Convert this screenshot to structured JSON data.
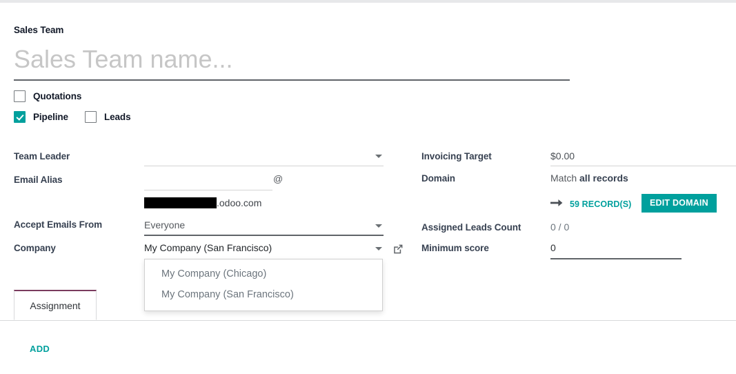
{
  "form": {
    "title_label": "Sales Team",
    "name_placeholder": "Sales Team name...",
    "name_value": ""
  },
  "options": [
    {
      "label": "Quotations",
      "checked": false
    },
    {
      "label": "Pipeline",
      "checked": true
    },
    {
      "label": "Leads",
      "checked": false
    }
  ],
  "left_fields": {
    "team_leader": {
      "label": "Team Leader",
      "value": ""
    },
    "email_alias": {
      "label": "Email Alias",
      "value": "",
      "at_symbol": "@",
      "domain_suffix": ".odoo.com",
      "domain_redacted": true
    },
    "accept_emails_from": {
      "label": "Accept Emails From",
      "value": "Everyone"
    },
    "company": {
      "label": "Company",
      "value": "My Company (San Francisco)"
    }
  },
  "right_fields": {
    "invoicing_target": {
      "label": "Invoicing Target",
      "value": "$0.00"
    },
    "domain": {
      "label": "Domain",
      "match_prefix": "Match ",
      "match_strong": "all records",
      "arrow_icon": "arrow-right-icon",
      "records_link": "59 RECORD(S)",
      "edit_button": "EDIT DOMAIN"
    },
    "assigned_leads_count": {
      "label": "Assigned Leads Count",
      "value": "0 / 0"
    },
    "minimum_score": {
      "label": "Minimum score",
      "value": "0"
    }
  },
  "company_dropdown": {
    "open": true,
    "items": [
      "My Company (Chicago)",
      "My Company (San Francisco)"
    ]
  },
  "tabs": [
    {
      "label": "Assignment",
      "active": true
    }
  ],
  "actions": {
    "add_label": "ADD"
  },
  "colors": {
    "accent_teal": "#00A09D",
    "tab_active_border": "#7a3b5e",
    "label_text": "#374151",
    "muted_text": "#6c757d"
  }
}
